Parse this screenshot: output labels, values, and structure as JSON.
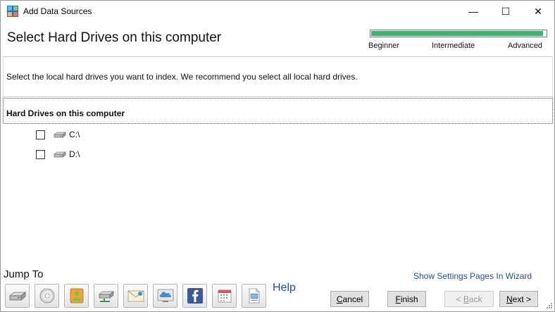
{
  "window": {
    "title": "Add Data Sources",
    "min_glyph": "—",
    "max_glyph": "☐",
    "close_glyph": "✕"
  },
  "header": {
    "page_title": "Select Hard Drives on this computer",
    "progress_fraction": 0.985,
    "levels": [
      "Beginner",
      "Intermediate",
      "Advanced"
    ]
  },
  "description": "Select the local hard drives you want to index. We recommend you select all local hard drives.",
  "section": {
    "title": "Hard Drives on this computer",
    "drives": [
      {
        "label": "C:\\",
        "checked": false
      },
      {
        "label": "D:\\",
        "checked": false
      }
    ]
  },
  "footer": {
    "jump_to": "Jump To",
    "jump_icons": [
      "hard-drive-icon",
      "disc-icon",
      "user-folder-icon",
      "network-drive-icon",
      "mail-icon",
      "cloud-icon",
      "facebook-icon",
      "calendar-icon",
      "document-icon"
    ],
    "help": "Help",
    "settings_link": "Show Settings Pages In Wizard",
    "buttons": {
      "cancel_key": "C",
      "cancel_rest": "ancel",
      "finish_key": "F",
      "finish_rest": "inish",
      "back_pre": "< ",
      "back_key": "B",
      "back_rest": "ack",
      "next_key": "N",
      "next_rest": "ext >"
    }
  },
  "colors": {
    "progress": "#3cb371",
    "link": "#1f4e99"
  }
}
